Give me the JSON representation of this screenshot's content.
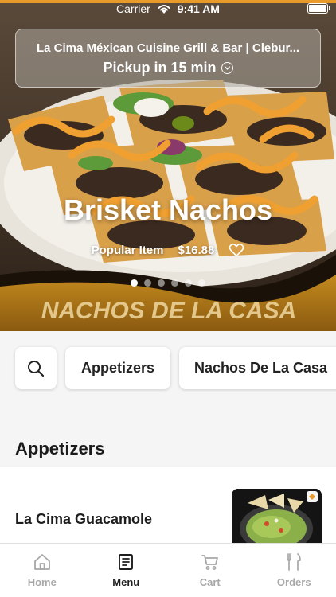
{
  "status_bar": {
    "carrier": "Carrier",
    "time": "9:41 AM"
  },
  "pickup": {
    "restaurant": "La Cima Méxican Cuisine Grill & Bar | Clebur...",
    "time_label": "Pickup in 15 min"
  },
  "hero": {
    "title": "Brisket Nachos",
    "tag": "Popular Item",
    "price": "$16.88",
    "banner_text": "NACHOS DE LA CASA",
    "slide_count": 6,
    "active_slide": 0
  },
  "categories": {
    "items": [
      "Appetizers",
      "Nachos De La Casa"
    ]
  },
  "section": {
    "title": "Appetizers",
    "items": [
      {
        "name": "La Cima Guacamole"
      }
    ]
  },
  "tabs": [
    {
      "label": "Home",
      "icon": "home-icon",
      "active": false
    },
    {
      "label": "Menu",
      "icon": "menu-icon",
      "active": true
    },
    {
      "label": "Cart",
      "icon": "cart-icon",
      "active": false
    },
    {
      "label": "Orders",
      "icon": "orders-icon",
      "active": false
    }
  ],
  "colors": {
    "accent": "#e89a2a",
    "active_tab": "#1e1e1e",
    "inactive_tab": "#a8a8a8"
  }
}
